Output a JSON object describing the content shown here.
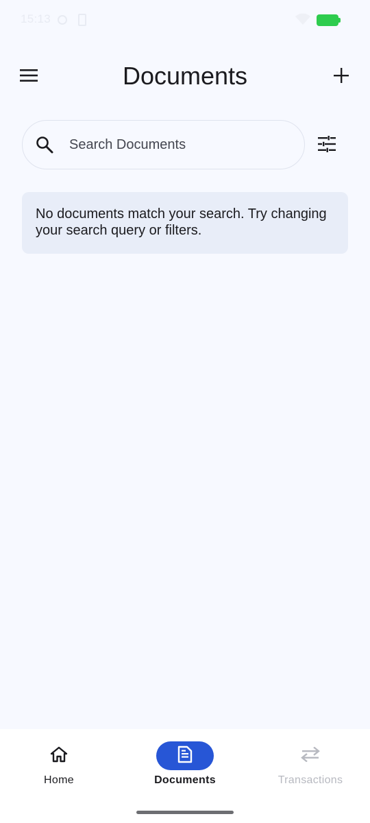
{
  "status_bar": {
    "time": "15:13"
  },
  "header": {
    "title": "Documents",
    "menu_icon": "menu-icon",
    "add_icon": "plus-icon"
  },
  "search": {
    "placeholder": "Search Documents",
    "value": "",
    "icon": "search-icon",
    "filter_icon": "tune-icon"
  },
  "empty_state": {
    "message": "No documents match your search. Try changing your search query or filters."
  },
  "bottom_nav": {
    "items": [
      {
        "label": "Home",
        "icon": "home-icon",
        "selected": false
      },
      {
        "label": "Documents",
        "icon": "document-icon",
        "selected": true
      },
      {
        "label": "Transactions",
        "icon": "swap-icon",
        "selected": false
      }
    ]
  },
  "colors": {
    "background": "#f7f9ff",
    "accent": "#2756d6",
    "card": "#e8edf8",
    "battery": "#2ecc4e"
  }
}
